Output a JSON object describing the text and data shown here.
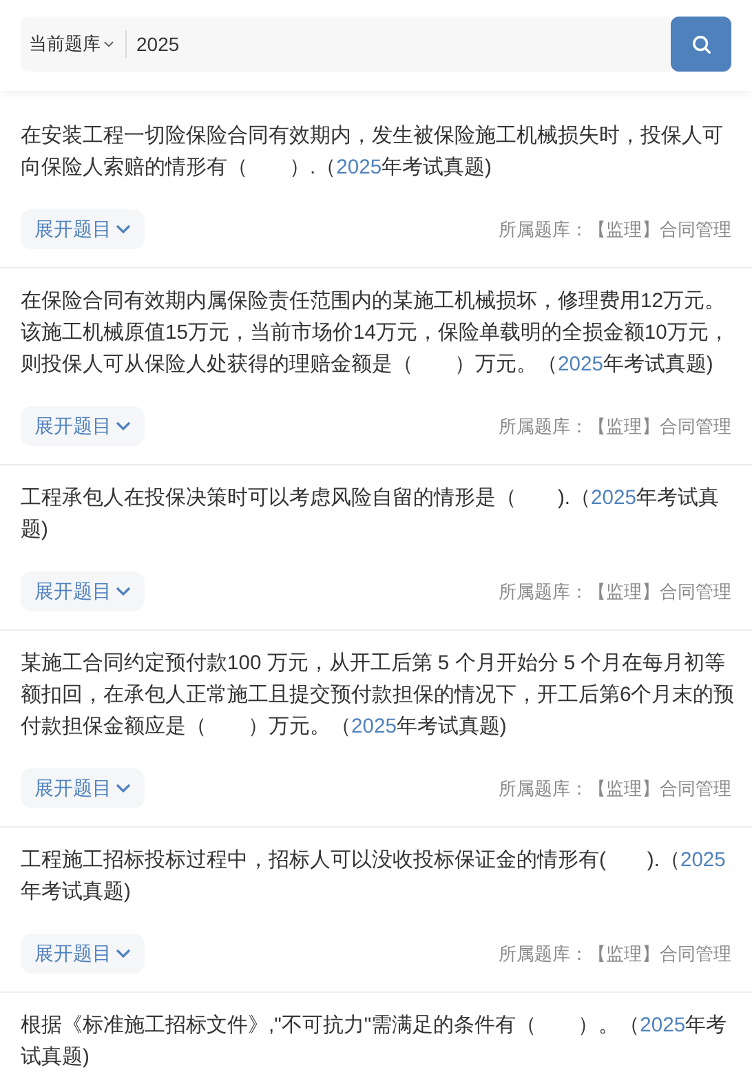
{
  "search": {
    "scope": "当前题库",
    "value": "2025"
  },
  "questions": [
    {
      "before": "在安装工程一切险保险合同有效期内，发生被保险施工机械损失时，投保人可向保险人索赔的情形有（　　）.（",
      "match": "2025",
      "after": "年考试真题)",
      "expand": "展开题目",
      "bank": "所属题库：【监理】合同管理"
    },
    {
      "before": "在保险合同有效期内属保险责任范围内的某施工机械损坏，修理费用12万元。该施工机械原值15万元，当前市场价14万元，保险单载明的全损金额10万元，则投保人可从保险人处获得的理赔金额是（　　）万元。（",
      "match": "2025",
      "after": "年考试真题)",
      "expand": "展开题目",
      "bank": "所属题库：【监理】合同管理"
    },
    {
      "before": "工程承包人在投保决策时可以考虑风险自留的情形是（　　).（",
      "match": "2025",
      "after": "年考试真题)",
      "expand": "展开题目",
      "bank": "所属题库：【监理】合同管理"
    },
    {
      "before": "某施工合同约定预付款100 万元，从开工后第 5 个月开始分 5 个月在每月初等额扣回，在承包人正常施工且提交预付款担保的情况下，开工后第6个月末的预付款担保金额应是（　　）万元。（",
      "match": "2025",
      "after": "年考试真题)",
      "expand": "展开题目",
      "bank": "所属题库：【监理】合同管理"
    },
    {
      "before": "工程施工招标投标过程中，招标人可以没收投标保证金的情形有(　　).（",
      "match": "2025",
      "after": "年考试真题)",
      "expand": "展开题目",
      "bank": "所属题库：【监理】合同管理"
    },
    {
      "before": "根据《标准施工招标文件》,\"不可抗力\"需满足的条件有（　　）。（",
      "match": "2025",
      "after": "年考试真题)"
    }
  ]
}
